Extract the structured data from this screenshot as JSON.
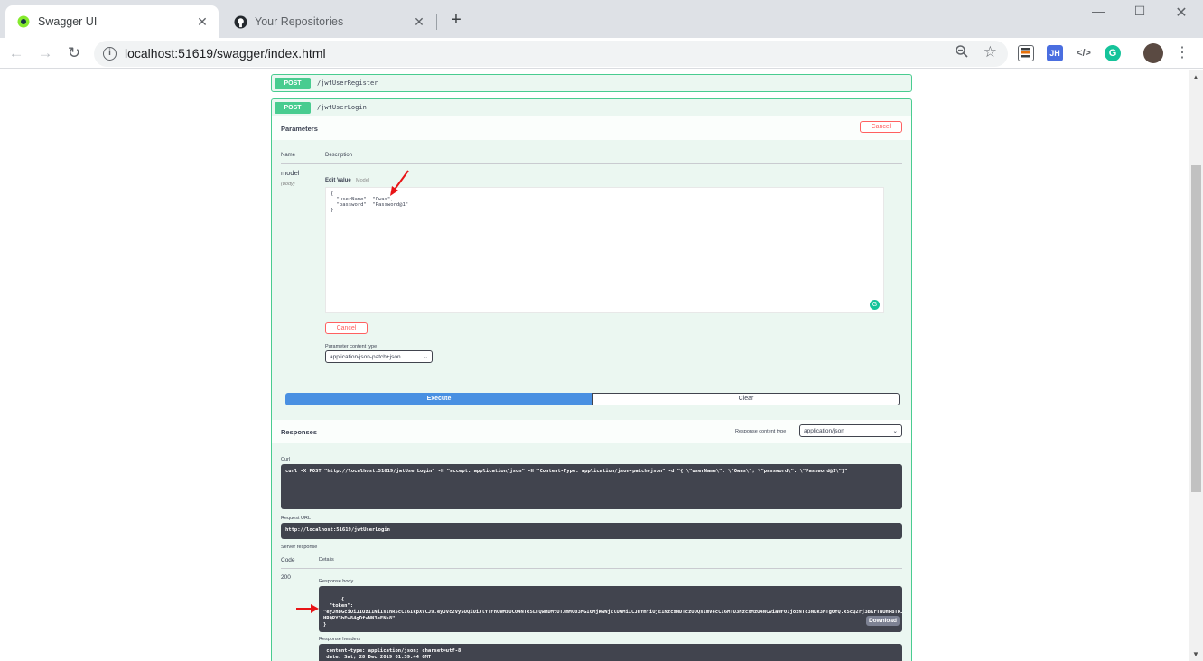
{
  "browser": {
    "tabs": [
      {
        "title": "Swagger UI",
        "active": true
      },
      {
        "title": "Your Repositories",
        "active": false
      }
    ],
    "url": "localhost:51619/swagger/index.html",
    "extensions": [
      "JH",
      "</>",
      "G"
    ]
  },
  "operations": [
    {
      "method": "POST",
      "path": "/jwtUserRegister"
    },
    {
      "method": "POST",
      "path": "/jwtUserLogin"
    }
  ],
  "params": {
    "section_title": "Parameters",
    "cancel_label": "Cancel",
    "col_name": "Name",
    "col_description": "Description",
    "param_name": "model",
    "param_in": "(body)",
    "edit_value_tab": "Edit Value",
    "model_tab": "Model",
    "body_value": "{\n  \"userName\": \"Owas\",\n  \"password\": \"Password@1\"\n}",
    "cancel_label_2": "Cancel",
    "content_type_label": "Parameter content type",
    "content_type_value": "application/json-patch+json",
    "execute_label": "Execute",
    "clear_label": "Clear"
  },
  "responses": {
    "section_title": "Responses",
    "content_type_label": "Response content type",
    "content_type_value": "application/json",
    "curl_label": "Curl",
    "curl_value": "curl -X POST \"http://localhost:51619/jwtUserLogin\" -H \"accept: application/json\" -H \"Content-Type: application/json-patch+json\" -d \"{ \\\"userName\\\": \\\"Owas\\\", \\\"password\\\": \\\"Password@1\\\"}\"",
    "request_url_label": "Request URL",
    "request_url_value": "http://localhost:51619/jwtUserLogin",
    "server_response_label": "Server response",
    "col_code": "Code",
    "col_details": "Details",
    "code": "200",
    "response_body_label": "Response body",
    "response_body": "{\n  \"token\":\n\"eyJhbGciOiJIUzI1NiIsInR5cCI6IkpXVCJ9.eyJVc2VySUQiOiJlYTFhOWMzOC04NTk5LTQwMDMtOTJmMC03MGI0MjkwNjZlOWMiLCJuYmYiOjE1NzcxNDTczODQsImV4cCI6MTU3NzcxMzU4NCwiaWF0IjoxNTc3NDk3MTg0fQ.k5cQ2rj3BKrTWUHRBTkJ\nHRQRY3bFw84gDfvNN3eFNs8\"\n}",
    "download_label": "Download",
    "response_headers_label": "Response headers",
    "response_headers": " content-type: application/json; charset=utf-8\n date: Sat, 28 Dec 2019 01:39:44 GMT"
  },
  "colors": {
    "post": "#49cc90",
    "execute": "#4990e2",
    "dark_panel": "#41444e",
    "cancel": "#ff6060",
    "arrow": "#e81416"
  }
}
